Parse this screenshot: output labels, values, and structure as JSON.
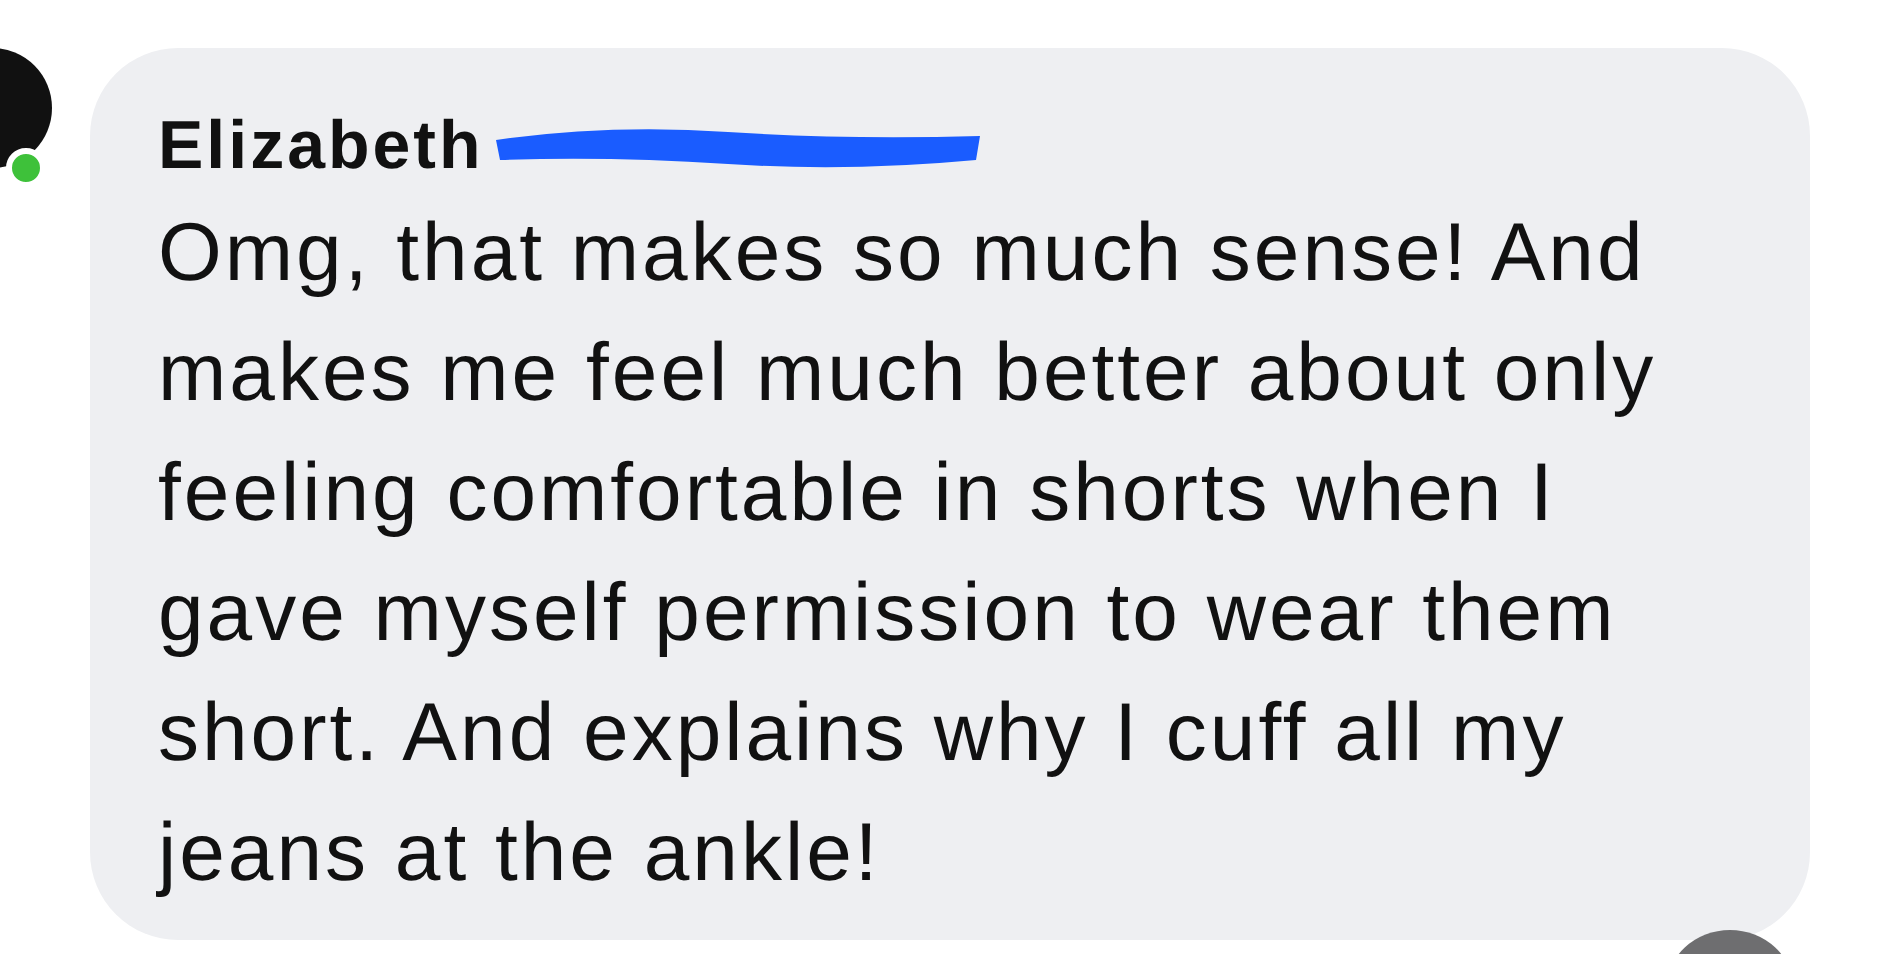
{
  "comment": {
    "author": {
      "name": "Elizabeth",
      "online": true
    },
    "text_lines": [
      "Omg, that makes so much sense! And",
      "makes me feel much better about only",
      "feeling comfortable in shorts when I",
      "gave myself permission to wear them",
      "short. And explains why I cuff all my",
      "jeans at the ankle!"
    ]
  }
}
